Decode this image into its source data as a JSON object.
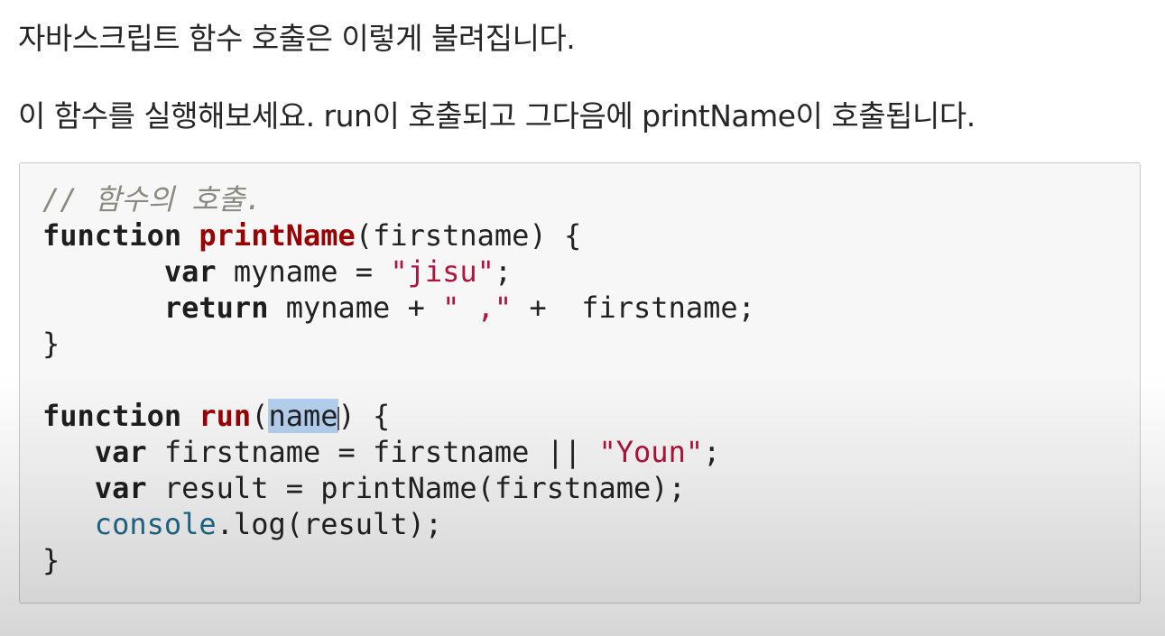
{
  "paragraphs": {
    "p1": "자바스크립트 함수 호출은 이렇게 불려집니다.",
    "p2": "이 함수를 실행해보세요. run이 호출되고 그다음에 printName이 호출됩니다."
  },
  "code": {
    "l1": {
      "comment": "// 함수의 호출."
    },
    "l2": {
      "kw": "function",
      "fn": "printName",
      "rest": "(firstname) {"
    },
    "l3": {
      "indent": "       ",
      "kw": "var",
      "mid": " myname = ",
      "str": "\"jisu\"",
      "end": ";"
    },
    "l4": {
      "indent": "       ",
      "kw": "return",
      "mid": " myname + ",
      "str": "\" ,\"",
      "end": " +  firstname;"
    },
    "l5": {
      "text": "}"
    },
    "l7": {
      "kw": "function",
      "fn": "run",
      "open": "(",
      "sel": "name",
      "rest": ") {"
    },
    "l8": {
      "indent": "   ",
      "kw": "var",
      "mid": " firstname = firstname || ",
      "str": "\"Youn\"",
      "end": ";"
    },
    "l9": {
      "indent": "   ",
      "kw": "var",
      "mid": " result = printName(firstname);"
    },
    "l10": {
      "indent": "   ",
      "builtin": "console",
      "rest": ".log(result);"
    },
    "l11": {
      "text": "}"
    }
  },
  "colors": {
    "keyword": "#1e1e1e",
    "function_name": "#990000",
    "string": "#b3123a",
    "builtin": "#1f6a8c",
    "comment": "#8a8a80",
    "selection": "#b5d0f0",
    "code_background": "#f7f7f7"
  },
  "icons": {
    "cursor": "text-cursor-icon"
  }
}
